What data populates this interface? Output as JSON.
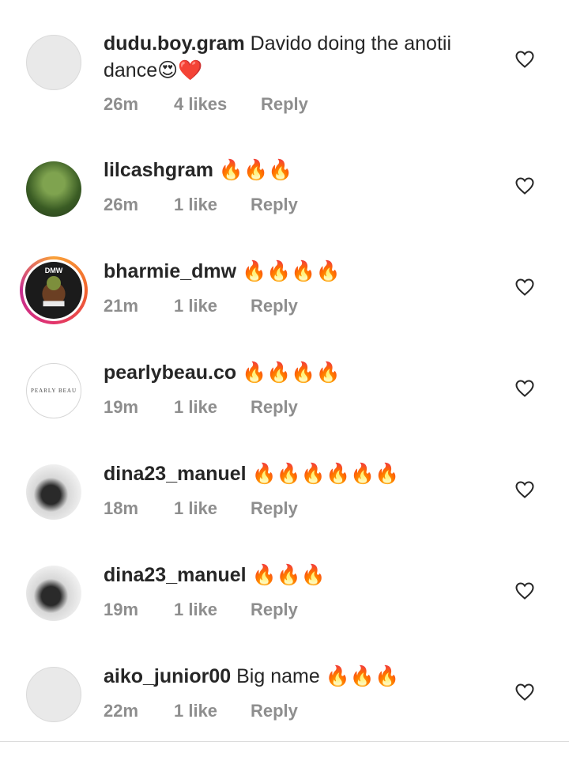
{
  "comments": [
    {
      "user": "dudu.boy.gram",
      "text": "Davido doing  the anotii dance😍❤️",
      "time": "26m",
      "likes": "4 likes",
      "reply": "Reply",
      "avatar": "blank-avatar"
    },
    {
      "user": "lilcashgram",
      "text": "🔥🔥🔥",
      "time": "26m",
      "likes": "1 like",
      "reply": "Reply",
      "avatar": "photo-avatar"
    },
    {
      "user": "bharmie_dmw",
      "text": "🔥🔥🔥🔥",
      "time": "21m",
      "likes": "1 like",
      "reply": "Reply",
      "avatar": "dmw-logo-avatar",
      "avatar_text": "DMW"
    },
    {
      "user": "pearlybeau.co",
      "text": "🔥🔥🔥🔥",
      "time": "19m",
      "likes": "1 like",
      "reply": "Reply",
      "avatar": "brand-logo-avatar",
      "avatar_text": "PEARLY BEAU"
    },
    {
      "user": "dina23_manuel",
      "text": "🔥🔥🔥🔥🔥🔥",
      "time": "18m",
      "likes": "1 like",
      "reply": "Reply",
      "avatar": "photo-avatar"
    },
    {
      "user": "dina23_manuel",
      "text": "🔥🔥🔥",
      "time": "19m",
      "likes": "1 like",
      "reply": "Reply",
      "avatar": "photo-avatar"
    },
    {
      "user": "aiko_junior00",
      "text": "Big name 🔥🔥🔥",
      "time": "22m",
      "likes": "1 like",
      "reply": "Reply",
      "avatar": "blank-avatar"
    }
  ],
  "icons": {
    "like": "heart-outline-icon"
  },
  "colors": {
    "text": "#262626",
    "meta": "#8e8e8e",
    "ring_start": "#f9a23a",
    "ring_end": "#c72f90"
  }
}
